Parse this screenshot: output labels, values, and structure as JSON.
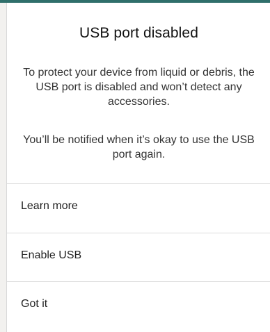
{
  "dialog": {
    "title": "USB port disabled",
    "message_1": "To protect your device from liquid or debris, the USB port is disabled and won’t detect any accessories.",
    "message_2": "You’ll be notified when it’s okay to use the USB port again.",
    "actions": [
      {
        "label": "Learn more"
      },
      {
        "label": "Enable USB"
      },
      {
        "label": "Got it"
      }
    ]
  }
}
